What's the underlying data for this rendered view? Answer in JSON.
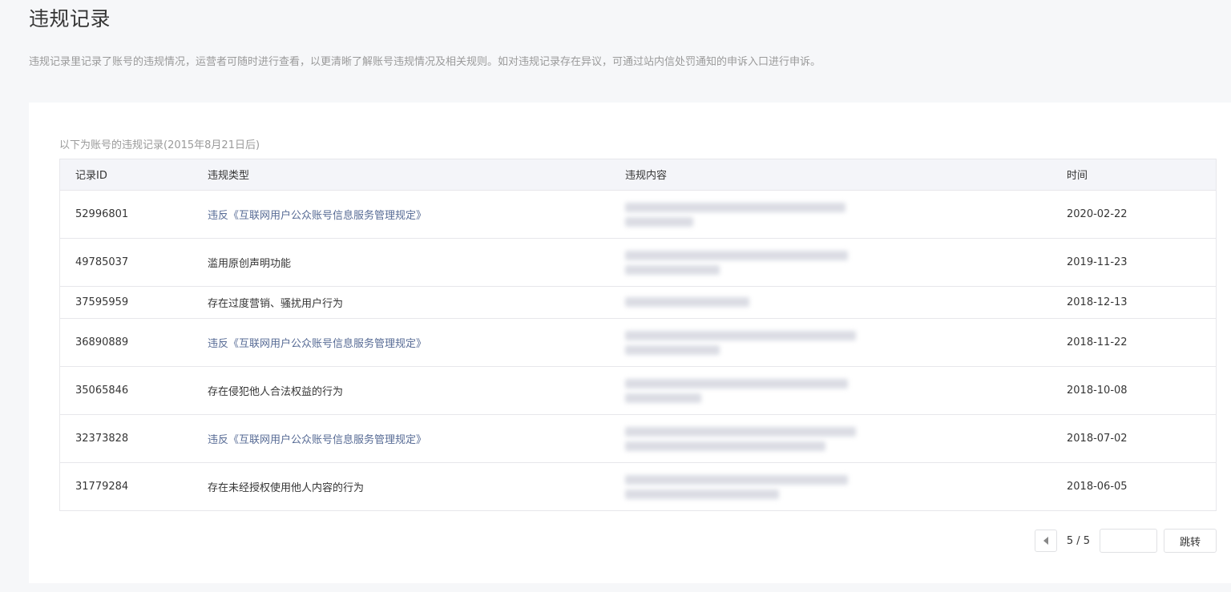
{
  "page": {
    "title": "违规记录",
    "description": "违规记录里记录了账号的违规情况，运营者可随时进行查看，以更清晰了解账号违规情况及相关规则。如对违规记录存在异议，可通过站内信处罚通知的申诉入口进行申诉。"
  },
  "records": {
    "caption": "以下为账号的违规记录(2015年8月21日后)",
    "columns": [
      "记录ID",
      "违规类型",
      "违规内容",
      "时间"
    ],
    "rows": [
      {
        "id": "52996801",
        "type": "违反《互联网用户公众账号信息服务管理规定》",
        "content": "",
        "date": "2020-02-22"
      },
      {
        "id": "49785037",
        "type": "滥用原创声明功能",
        "content": "",
        "date": "2019-11-23"
      },
      {
        "id": "37595959",
        "type": "存在过度营销、骚扰用户行为",
        "content": "",
        "date": "2018-12-13"
      },
      {
        "id": "36890889",
        "type": "违反《互联网用户公众账号信息服务管理规定》",
        "content": "",
        "date": "2018-11-22"
      },
      {
        "id": "35065846",
        "type": "存在侵犯他人合法权益的行为",
        "content": "",
        "date": "2018-10-08"
      },
      {
        "id": "32373828",
        "type": "违反《互联网用户公众账号信息服务管理规定》",
        "content": "",
        "date": "2018-07-02"
      },
      {
        "id": "31779284",
        "type": "存在未经授权使用他人内容的行为",
        "content": "",
        "date": "2018-06-05"
      }
    ]
  },
  "pager": {
    "page_display": "5 / 5",
    "jump_input_value": "",
    "jump_label": "跳转"
  },
  "colors": {
    "link": "#576b95",
    "page_bg": "#f6f7f9"
  }
}
